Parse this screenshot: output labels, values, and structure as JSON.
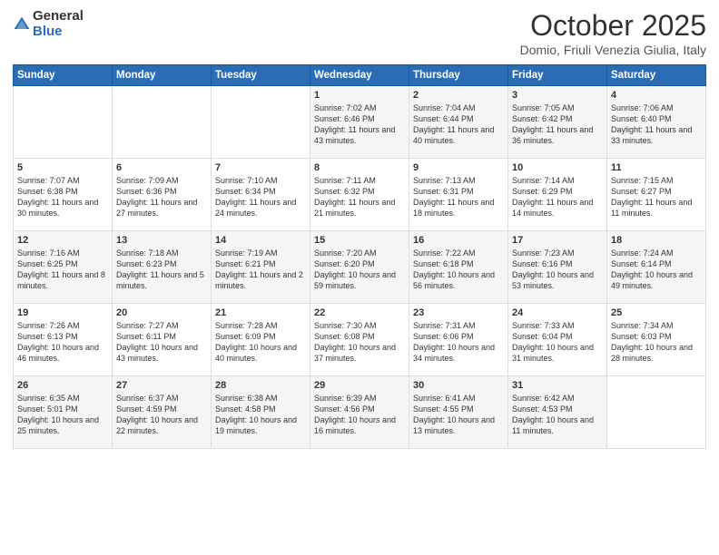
{
  "logo": {
    "general": "General",
    "blue": "Blue"
  },
  "title": "October 2025",
  "subtitle": "Domio, Friuli Venezia Giulia, Italy",
  "days_of_week": [
    "Sunday",
    "Monday",
    "Tuesday",
    "Wednesday",
    "Thursday",
    "Friday",
    "Saturday"
  ],
  "weeks": [
    [
      {
        "day": "",
        "text": ""
      },
      {
        "day": "",
        "text": ""
      },
      {
        "day": "",
        "text": ""
      },
      {
        "day": "1",
        "text": "Sunrise: 7:02 AM\nSunset: 6:46 PM\nDaylight: 11 hours and 43 minutes."
      },
      {
        "day": "2",
        "text": "Sunrise: 7:04 AM\nSunset: 6:44 PM\nDaylight: 11 hours and 40 minutes."
      },
      {
        "day": "3",
        "text": "Sunrise: 7:05 AM\nSunset: 6:42 PM\nDaylight: 11 hours and 36 minutes."
      },
      {
        "day": "4",
        "text": "Sunrise: 7:06 AM\nSunset: 6:40 PM\nDaylight: 11 hours and 33 minutes."
      }
    ],
    [
      {
        "day": "5",
        "text": "Sunrise: 7:07 AM\nSunset: 6:38 PM\nDaylight: 11 hours and 30 minutes."
      },
      {
        "day": "6",
        "text": "Sunrise: 7:09 AM\nSunset: 6:36 PM\nDaylight: 11 hours and 27 minutes."
      },
      {
        "day": "7",
        "text": "Sunrise: 7:10 AM\nSunset: 6:34 PM\nDaylight: 11 hours and 24 minutes."
      },
      {
        "day": "8",
        "text": "Sunrise: 7:11 AM\nSunset: 6:32 PM\nDaylight: 11 hours and 21 minutes."
      },
      {
        "day": "9",
        "text": "Sunrise: 7:13 AM\nSunset: 6:31 PM\nDaylight: 11 hours and 18 minutes."
      },
      {
        "day": "10",
        "text": "Sunrise: 7:14 AM\nSunset: 6:29 PM\nDaylight: 11 hours and 14 minutes."
      },
      {
        "day": "11",
        "text": "Sunrise: 7:15 AM\nSunset: 6:27 PM\nDaylight: 11 hours and 11 minutes."
      }
    ],
    [
      {
        "day": "12",
        "text": "Sunrise: 7:16 AM\nSunset: 6:25 PM\nDaylight: 11 hours and 8 minutes."
      },
      {
        "day": "13",
        "text": "Sunrise: 7:18 AM\nSunset: 6:23 PM\nDaylight: 11 hours and 5 minutes."
      },
      {
        "day": "14",
        "text": "Sunrise: 7:19 AM\nSunset: 6:21 PM\nDaylight: 11 hours and 2 minutes."
      },
      {
        "day": "15",
        "text": "Sunrise: 7:20 AM\nSunset: 6:20 PM\nDaylight: 10 hours and 59 minutes."
      },
      {
        "day": "16",
        "text": "Sunrise: 7:22 AM\nSunset: 6:18 PM\nDaylight: 10 hours and 56 minutes."
      },
      {
        "day": "17",
        "text": "Sunrise: 7:23 AM\nSunset: 6:16 PM\nDaylight: 10 hours and 53 minutes."
      },
      {
        "day": "18",
        "text": "Sunrise: 7:24 AM\nSunset: 6:14 PM\nDaylight: 10 hours and 49 minutes."
      }
    ],
    [
      {
        "day": "19",
        "text": "Sunrise: 7:26 AM\nSunset: 6:13 PM\nDaylight: 10 hours and 46 minutes."
      },
      {
        "day": "20",
        "text": "Sunrise: 7:27 AM\nSunset: 6:11 PM\nDaylight: 10 hours and 43 minutes."
      },
      {
        "day": "21",
        "text": "Sunrise: 7:28 AM\nSunset: 6:09 PM\nDaylight: 10 hours and 40 minutes."
      },
      {
        "day": "22",
        "text": "Sunrise: 7:30 AM\nSunset: 6:08 PM\nDaylight: 10 hours and 37 minutes."
      },
      {
        "day": "23",
        "text": "Sunrise: 7:31 AM\nSunset: 6:06 PM\nDaylight: 10 hours and 34 minutes."
      },
      {
        "day": "24",
        "text": "Sunrise: 7:33 AM\nSunset: 6:04 PM\nDaylight: 10 hours and 31 minutes."
      },
      {
        "day": "25",
        "text": "Sunrise: 7:34 AM\nSunset: 6:03 PM\nDaylight: 10 hours and 28 minutes."
      }
    ],
    [
      {
        "day": "26",
        "text": "Sunrise: 6:35 AM\nSunset: 5:01 PM\nDaylight: 10 hours and 25 minutes."
      },
      {
        "day": "27",
        "text": "Sunrise: 6:37 AM\nSunset: 4:59 PM\nDaylight: 10 hours and 22 minutes."
      },
      {
        "day": "28",
        "text": "Sunrise: 6:38 AM\nSunset: 4:58 PM\nDaylight: 10 hours and 19 minutes."
      },
      {
        "day": "29",
        "text": "Sunrise: 6:39 AM\nSunset: 4:56 PM\nDaylight: 10 hours and 16 minutes."
      },
      {
        "day": "30",
        "text": "Sunrise: 6:41 AM\nSunset: 4:55 PM\nDaylight: 10 hours and 13 minutes."
      },
      {
        "day": "31",
        "text": "Sunrise: 6:42 AM\nSunset: 4:53 PM\nDaylight: 10 hours and 11 minutes."
      },
      {
        "day": "",
        "text": ""
      }
    ]
  ]
}
